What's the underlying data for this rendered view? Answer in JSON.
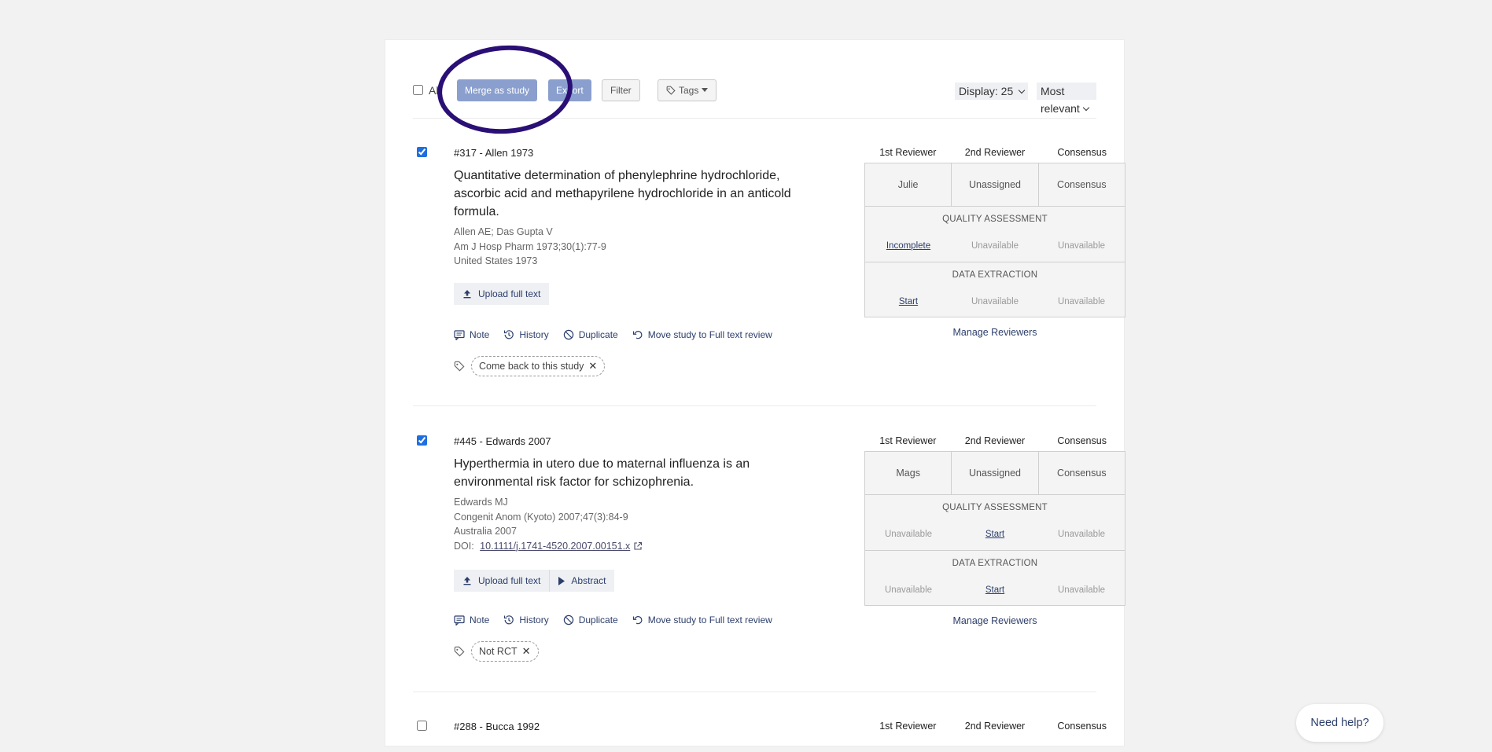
{
  "toolbar": {
    "all_label": "All",
    "merge_label": "Merge as study",
    "export_label": "Export",
    "filter_label": "Filter",
    "tags_label": "Tags",
    "display_label": "Display: 25",
    "sort_label": "Most relevant"
  },
  "reviewer_headers": [
    "1st Reviewer",
    "2nd Reviewer",
    "Consensus"
  ],
  "studies": [
    {
      "checked": true,
      "id_label": "#317 - Allen 1973",
      "title": "Quantitative determination of phenylephrine hydrochloride, ascorbic acid and methapyrilene hydrochloride in an anticold formula.",
      "authors": "Allen AE; Das Gupta V",
      "journal": "Am J Hosp Pharm 1973;30(1):77-9",
      "country_year": "United States 1973",
      "upload_label": "Upload full text",
      "actions": {
        "note": "Note",
        "history": "History",
        "duplicate": "Duplicate",
        "move": "Move study to Full text review"
      },
      "tags": [
        "Come back to this study"
      ],
      "reviewers": [
        "Julie",
        "Unassigned",
        "Consensus"
      ],
      "quality_title": "QUALITY ASSESSMENT",
      "quality": [
        "Incomplete",
        "Unavailable",
        "Unavailable"
      ],
      "extraction_title": "DATA EXTRACTION",
      "extraction": [
        "Start",
        "Unavailable",
        "Unavailable"
      ],
      "manage_label": "Manage Reviewers"
    },
    {
      "checked": true,
      "id_label": "#445 - Edwards 2007",
      "title": "Hyperthermia in utero due to maternal influenza is an environmental risk factor for schizophrenia.",
      "authors": "Edwards MJ",
      "journal": "Congenit Anom (Kyoto) 2007;47(3):84-9",
      "country_year": "Australia 2007",
      "doi_prefix": "DOI: ",
      "doi": "10.1111/j.1741-4520.2007.00151.x",
      "upload_label": "Upload full text",
      "abstract_label": "Abstract",
      "actions": {
        "note": "Note",
        "history": "History",
        "duplicate": "Duplicate",
        "move": "Move study to Full text review"
      },
      "tags": [
        "Not RCT"
      ],
      "reviewers": [
        "Mags",
        "Unassigned",
        "Consensus"
      ],
      "quality_title": "QUALITY ASSESSMENT",
      "quality": [
        "Unavailable",
        "Start",
        "Unavailable"
      ],
      "extraction_title": "DATA EXTRACTION",
      "extraction": [
        "Unavailable",
        "Start",
        "Unavailable"
      ],
      "manage_label": "Manage Reviewers"
    },
    {
      "checked": false,
      "id_label": "#288 - Bucca 1992"
    }
  ],
  "help_label": "Need help?",
  "colors": {
    "primary_button": "#8a9fcd",
    "link": "#2c3e6b",
    "annotation_circle": "#2a0f75",
    "checkbox": "#1f6fe0"
  },
  "icons": [
    "tag-icon",
    "upload-icon",
    "play-icon",
    "note-icon",
    "history-icon",
    "duplicate-icon",
    "undo-icon",
    "external-link-icon",
    "chevron-down-icon"
  ]
}
